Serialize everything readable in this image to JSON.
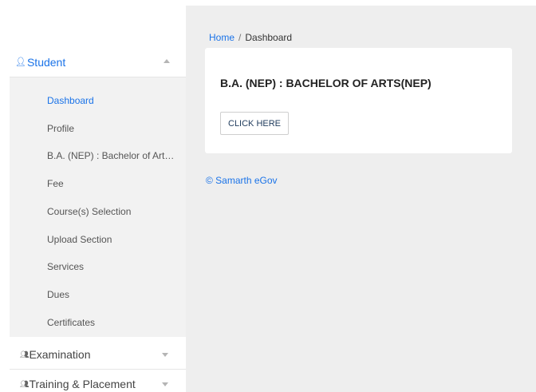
{
  "sidebar": {
    "student": {
      "icon": "user-icon",
      "label": "Student"
    },
    "items": [
      {
        "label": "Dashboard",
        "active": true
      },
      {
        "label": "Profile"
      },
      {
        "label": "B.A. (NEP) : Bachelor of Arts(NEP)"
      },
      {
        "label": "Fee"
      },
      {
        "label": "Course(s) Selection"
      },
      {
        "label": "Upload Section"
      },
      {
        "label": "Services"
      },
      {
        "label": "Dues"
      },
      {
        "label": "Certificates"
      }
    ],
    "groups": [
      {
        "icon": "users-icon",
        "label": "Examination"
      },
      {
        "icon": "users-icon",
        "label": "Training & Placement"
      }
    ]
  },
  "breadcrumb": {
    "home": "Home",
    "separator": "/",
    "current": "Dashboard"
  },
  "card": {
    "title": "B.A. (NEP) : BACHELOR OF ARTS(NEP)",
    "button_label": "CLICK HERE"
  },
  "footer": {
    "text": "© Samarth eGov"
  },
  "colors": {
    "accent": "#1a73e8",
    "main_bg": "#eeeeee",
    "submenu_bg": "#f2f2f2"
  }
}
